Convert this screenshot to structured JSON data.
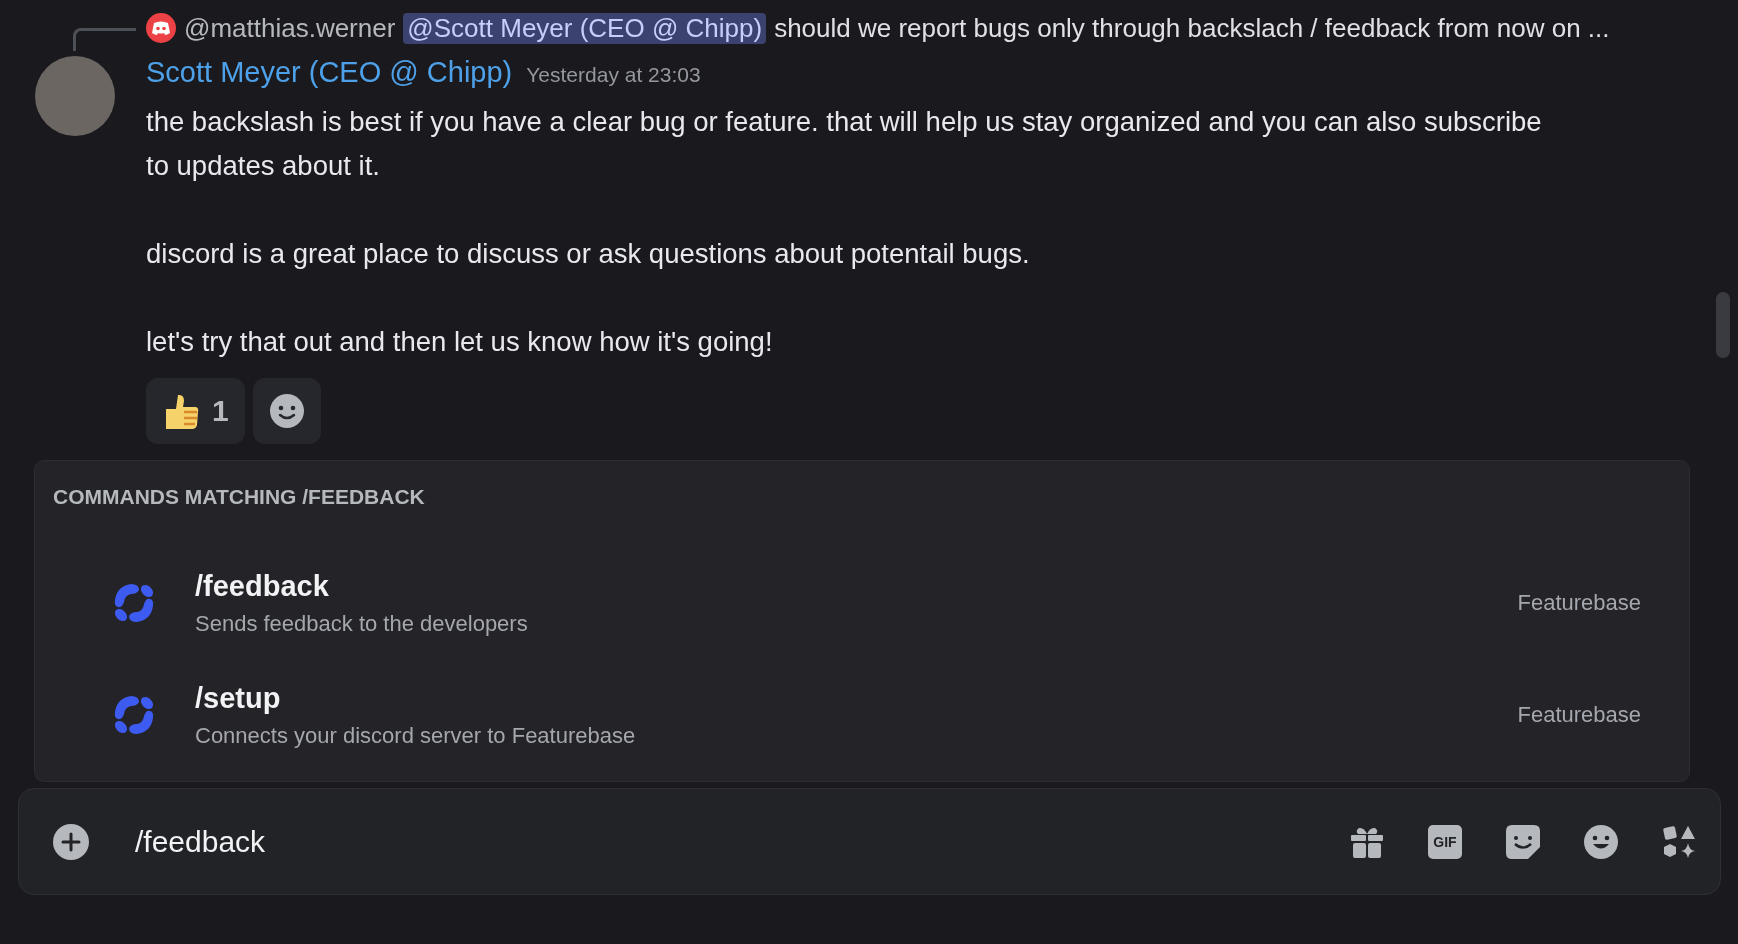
{
  "reply": {
    "author": "@matthias.werner",
    "mention": "@Scott Meyer (CEO @ Chipp)",
    "text": "should we report bugs only through backslach / feedback from now on ..."
  },
  "message": {
    "author": "Scott Meyer (CEO @ Chipp)",
    "timestamp": "Yesterday at 23:03",
    "paragraphs": [
      "the backslash is best if you have a clear bug or feature. that will help us stay organized and you can also subscribe to updates about it.",
      "discord is a great place to discuss or ask questions about potentail bugs.",
      "let's try that out and then let us know how it's going!"
    ],
    "reactions": [
      {
        "kind": "thumbs-up",
        "count": "1"
      },
      {
        "kind": "add"
      }
    ]
  },
  "autocomplete": {
    "title": "COMMANDS MATCHING /FEEDBACK",
    "commands": [
      {
        "name": "/feedback",
        "description": "Sends feedback to the developers",
        "app": "Featurebase"
      },
      {
        "name": "/setup",
        "description": "Connects your discord server to Featurebase",
        "app": "Featurebase"
      }
    ]
  },
  "composer": {
    "value": "/feedback",
    "gif_label": "GIF"
  }
}
